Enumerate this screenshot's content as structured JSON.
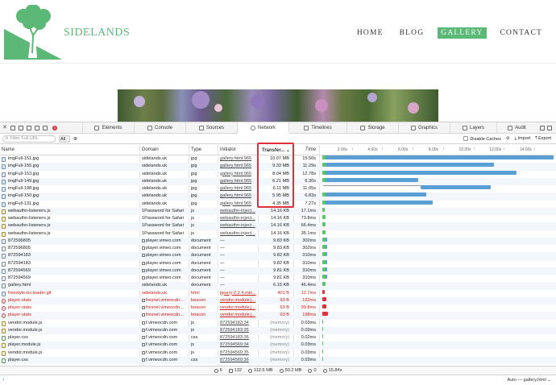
{
  "site": {
    "brand": "SIDELANDS",
    "nav": [
      "HOME",
      "BLOG",
      "GALLERY",
      "CONTACT"
    ],
    "active_nav": "GALLERY",
    "brand_color": "#5bb876"
  },
  "devtools": {
    "tabs": [
      {
        "label": "Elements",
        "icon": "elements-icon"
      },
      {
        "label": "Console",
        "icon": "console-icon"
      },
      {
        "label": "Sources",
        "icon": "sources-icon"
      },
      {
        "label": "Network",
        "icon": "network-icon"
      },
      {
        "label": "Timelines",
        "icon": "timelines-icon"
      },
      {
        "label": "Storage",
        "icon": "storage-icon"
      },
      {
        "label": "Graphics",
        "icon": "graphics-icon"
      },
      {
        "label": "Layers",
        "icon": "layers-icon"
      },
      {
        "label": "Audit",
        "icon": "audit-icon"
      }
    ],
    "selected_tab": "Network",
    "error_count": "1",
    "filter_placeholder": "Filter Full URL",
    "type_filter": "All",
    "disable_caches": "Disable Caches",
    "import": "Import",
    "export": "Export",
    "columns": {
      "name": "Name",
      "domain": "Domain",
      "type": "Type",
      "initiator": "Initiator",
      "transferred": "Transfer...",
      "time": "Time"
    },
    "ticks": [
      "2.00s",
      "4.00s",
      "6.00s",
      "8.00s",
      "10.00s",
      "12.00s",
      "14.00s"
    ],
    "rows": [
      {
        "name": "imgFull-151.jpg",
        "domain": "sidelands.uk",
        "type": "jpg",
        "initiator": "gallery.html:965",
        "size": "10.07 MB",
        "time": "15.50s",
        "icon": "img",
        "red": false,
        "mem": false
      },
      {
        "name": "imgFull-155.jpg",
        "domain": "sidelands.uk",
        "type": "jpg",
        "initiator": "gallery.html:965",
        "size": "9.33 MB",
        "time": "11.29s",
        "icon": "img",
        "red": false,
        "mem": false
      },
      {
        "name": "imgFull-153.jpg",
        "domain": "sidelands.uk",
        "type": "jpg",
        "initiator": "gallery.html:965",
        "size": "8.04 MB",
        "time": "12.78s",
        "icon": "img",
        "red": false,
        "mem": false
      },
      {
        "name": "imgFull-149.jpg",
        "domain": "sidelands.uk",
        "type": "jpg",
        "initiator": "gallery.html:965",
        "size": "6.21 MB",
        "time": "6.30s",
        "icon": "img",
        "red": false,
        "mem": false
      },
      {
        "name": "imgFull-198.jpg",
        "domain": "sidelands.uk",
        "type": "jpg",
        "initiator": "gallery.html:965",
        "size": "6.11 MB",
        "time": "11.05s",
        "icon": "img",
        "red": false,
        "mem": false
      },
      {
        "name": "imgFull-150.jpg",
        "domain": "sidelands.uk",
        "type": "jpg",
        "initiator": "gallery.html:965",
        "size": "5.95 MB",
        "time": "6.83s",
        "icon": "img",
        "red": false,
        "mem": false
      },
      {
        "name": "imgFull-131.jpg",
        "domain": "sidelands.uk",
        "type": "jpg",
        "initiator": "gallery.html:965",
        "size": "4.35 MB",
        "time": "7.27s",
        "icon": "img",
        "red": false,
        "mem": false
      },
      {
        "name": "webauthn-listeners.js",
        "domain": "1Password for Safari",
        "type": "js",
        "initiator": "webauthn-inject...",
        "size": "14.16 KB",
        "time": "17.1ms",
        "icon": "js",
        "red": false,
        "mem": false
      },
      {
        "name": "webauthn-listeners.js",
        "domain": "1Password for Safari",
        "type": "js",
        "initiator": "webauthn-inject...",
        "size": "14.16 KB",
        "time": "73.8ms",
        "icon": "js",
        "red": false,
        "mem": false
      },
      {
        "name": "webauthn-listeners.js",
        "domain": "1Password for Safari",
        "type": "js",
        "initiator": "webauthn-inject...",
        "size": "14.16 KB",
        "time": "66.4ms",
        "icon": "js",
        "red": false,
        "mem": false
      },
      {
        "name": "webauthn-listeners.js",
        "domain": "1Password for Safari",
        "type": "js",
        "initiator": "webauthn-inject...",
        "size": "14.16 KB",
        "time": "35.1ms",
        "icon": "js",
        "red": false,
        "mem": false
      },
      {
        "name": "872596805",
        "domain": "player.vimeo.com",
        "type": "document",
        "initiator": "—",
        "size": "9.83 KB",
        "time": "302ms",
        "icon": "doc",
        "red": false,
        "mem": false,
        "lock": true
      },
      {
        "name": "872596805",
        "domain": "player.vimeo.com",
        "type": "document",
        "initiator": "—",
        "size": "9.83 KB",
        "time": "302ms",
        "icon": "doc",
        "red": false,
        "mem": false,
        "lock": true
      },
      {
        "name": "872594183",
        "domain": "player.vimeo.com",
        "type": "document",
        "initiator": "—",
        "size": "9.82 KB",
        "time": "310ms",
        "icon": "doc",
        "red": false,
        "mem": false,
        "lock": true
      },
      {
        "name": "872594183",
        "domain": "player.vimeo.com",
        "type": "document",
        "initiator": "—",
        "size": "9.82 KB",
        "time": "310ms",
        "icon": "doc",
        "red": false,
        "mem": false,
        "lock": true
      },
      {
        "name": "872594569",
        "domain": "player.vimeo.com",
        "type": "document",
        "initiator": "—",
        "size": "9.81 KB",
        "time": "310ms",
        "icon": "doc",
        "red": false,
        "mem": false,
        "lock": true
      },
      {
        "name": "872594569",
        "domain": "player.vimeo.com",
        "type": "document",
        "initiator": "—",
        "size": "9.81 KB",
        "time": "310ms",
        "icon": "doc",
        "red": false,
        "mem": false,
        "lock": true
      },
      {
        "name": "gallery.html",
        "domain": "sidelands.uk",
        "type": "document",
        "initiator": "—",
        "size": "6.15 KB",
        "time": "46.4ms",
        "icon": "doc",
        "red": false,
        "mem": false
      },
      {
        "name": "freestyle-bx-loader.gif",
        "domain": "sidelands.uk",
        "type": "html",
        "initiator": "jquery-2.2.4.min...",
        "size": "401 B",
        "time": "12.7ms",
        "icon": "img",
        "red": true,
        "mem": false
      },
      {
        "name": "player-stats",
        "domain": "fresnel.vimeocdn...",
        "type": "beacon",
        "initiator": "vendor.module.j...",
        "size": "63 B",
        "time": "132ms",
        "icon": "beacon",
        "red": true,
        "mem": false,
        "lock": true
      },
      {
        "name": "player-stats",
        "domain": "fresnel.vimeocdn...",
        "type": "beacon",
        "initiator": "vendor.module.j...",
        "size": "63 B",
        "time": "99.8ms",
        "icon": "beacon",
        "red": true,
        "mem": false,
        "lock": true
      },
      {
        "name": "player-stats",
        "domain": "fresnel.vimeocdn...",
        "type": "beacon",
        "initiator": "vendor.module.j...",
        "size": "63 B",
        "time": "198ms",
        "icon": "beacon",
        "red": true,
        "mem": false,
        "lock": true
      },
      {
        "name": "vendor.module.js",
        "domain": "f.vimeocdn.com",
        "type": "js",
        "initiator": "872594183:34",
        "size": "(memory)",
        "time": "0.03ms",
        "icon": "js",
        "red": false,
        "mem": true,
        "lock": true
      },
      {
        "name": "vendor.module.js",
        "domain": "f.vimeocdn.com",
        "type": "js",
        "initiator": "872594183:35",
        "size": "(memory)",
        "time": "0.03ms",
        "icon": "js",
        "red": false,
        "mem": true,
        "lock": true
      },
      {
        "name": "player.css",
        "domain": "f.vimeocdn.com",
        "type": "css",
        "initiator": "872594183:36",
        "size": "(memory)",
        "time": "0.02ms",
        "icon": "css",
        "red": false,
        "mem": true,
        "lock": true
      },
      {
        "name": "player.module.js",
        "domain": "f.vimeocdn.com",
        "type": "js",
        "initiator": "872594569:34",
        "size": "(memory)",
        "time": "0.03ms",
        "icon": "js",
        "red": false,
        "mem": true,
        "lock": true
      },
      {
        "name": "vendor.module.js",
        "domain": "f.vimeocdn.com",
        "type": "js",
        "initiator": "872594569:35",
        "size": "(memory)",
        "time": "0.03ms",
        "icon": "js",
        "red": false,
        "mem": true,
        "lock": true
      },
      {
        "name": "player.css",
        "domain": "f.vimeocdn.com",
        "type": "css",
        "initiator": "872594569:36",
        "size": "(memory)",
        "time": "0.03ms",
        "icon": "css",
        "red": false,
        "mem": true,
        "lock": true
      }
    ],
    "waterfall_colors": {
      "download": "#5a9fd4",
      "short": "#5bc668",
      "highlight": "#e2303a"
    },
    "status": {
      "requests": "6",
      "resources": "132",
      "transferred": "112.6 MB",
      "resources_size": "50.2 MB",
      "errors": "0",
      "time": "15.84s"
    },
    "console_context": "Auto — gallery.html"
  }
}
